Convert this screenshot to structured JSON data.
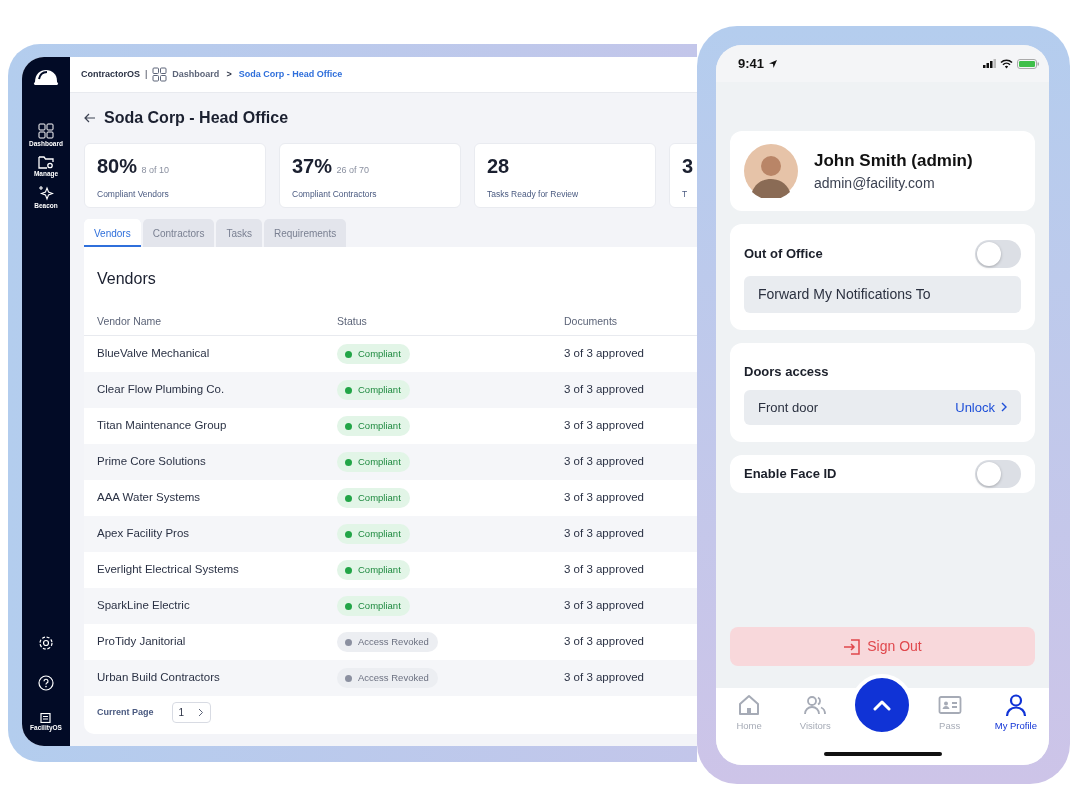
{
  "tablet": {
    "sidebar": {
      "items": [
        {
          "label": "Dashboard"
        },
        {
          "label": "Manage"
        },
        {
          "label": "Beacon"
        }
      ],
      "footer": "FacilityOS"
    },
    "breadcrumb": {
      "app": "ContractorOS",
      "separator": "|",
      "divider": ">",
      "items": [
        {
          "label": "Dashboard",
          "selected": false
        },
        {
          "label": "Soda Corp - Head Office",
          "selected": true
        }
      ]
    },
    "title": "Soda Corp - Head Office",
    "stats": [
      {
        "value": "80%",
        "detail": "8 of 10",
        "label": "Compliant Vendors"
      },
      {
        "value": "37%",
        "detail": "26 of 70",
        "label": "Compliant Contractors"
      },
      {
        "value": "28",
        "label": "Tasks Ready for Review"
      },
      {
        "value": "3",
        "label": "T"
      }
    ],
    "tabs": [
      {
        "label": "Vendors",
        "selected": true
      },
      {
        "label": "Contractors",
        "selected": false
      },
      {
        "label": "Tasks",
        "selected": false
      },
      {
        "label": "Requirements",
        "selected": false
      }
    ],
    "table": {
      "title": "Vendors",
      "columns": [
        "Vendor Name",
        "Status",
        "Documents"
      ],
      "rows": [
        {
          "name": "BlueValve Mechanical",
          "status": {
            "label": "Compliant",
            "kind": "compliant"
          },
          "documents": "3 of 3 approved"
        },
        {
          "name": "Clear Flow Plumbing Co.",
          "status": {
            "label": "Compliant",
            "kind": "compliant"
          },
          "documents": "3 of 3 approved"
        },
        {
          "name": "Titan Maintenance Group",
          "status": {
            "label": "Compliant",
            "kind": "compliant"
          },
          "documents": "3 of 3 approved"
        },
        {
          "name": "Prime Core Solutions",
          "status": {
            "label": "Compliant",
            "kind": "compliant"
          },
          "documents": "3 of 3 approved"
        },
        {
          "name": "AAA Water Systems",
          "status": {
            "label": "Compliant",
            "kind": "compliant"
          },
          "documents": "3 of 3 approved"
        },
        {
          "name": "Apex Facility Pros",
          "status": {
            "label": "Compliant",
            "kind": "compliant"
          },
          "documents": "3 of 3 approved"
        },
        {
          "name": "Everlight Electrical Systems",
          "status": {
            "label": "Compliant",
            "kind": "compliant"
          },
          "documents": "3 of 3 approved"
        },
        {
          "name": "SparkLine Electric",
          "status": {
            "label": "Compliant",
            "kind": "compliant"
          },
          "documents": "3 of 3 approved"
        },
        {
          "name": "ProTidy Janitorial",
          "status": {
            "label": "Access Revoked",
            "kind": "revoked"
          },
          "documents": "3 of 3 approved"
        },
        {
          "name": "Urban Build Contractors",
          "status": {
            "label": "Access Revoked",
            "kind": "revoked"
          },
          "documents": "3 of 3 approved"
        }
      ]
    },
    "pagination": {
      "label": "Current Page",
      "value": "1"
    }
  },
  "phone": {
    "status_bar": {
      "time": "9:41"
    },
    "profile": {
      "name": "John Smith (admin)",
      "email": "admin@facility.com"
    },
    "out_of_office": {
      "label": "Out of Office",
      "on": false
    },
    "forward_button": "Forward My Notifications To",
    "doors": {
      "title": "Doors access",
      "items": [
        {
          "name": "Front door",
          "action": "Unlock"
        }
      ]
    },
    "face_id": {
      "label": "Enable Face ID",
      "on": false
    },
    "sign_out": "Sign Out",
    "tab_bar": [
      {
        "label": "Home",
        "selected": false
      },
      {
        "label": "Visitors",
        "selected": false
      },
      {
        "label": "Pass",
        "selected": false
      },
      {
        "label": "My Profile",
        "selected": true
      }
    ]
  }
}
